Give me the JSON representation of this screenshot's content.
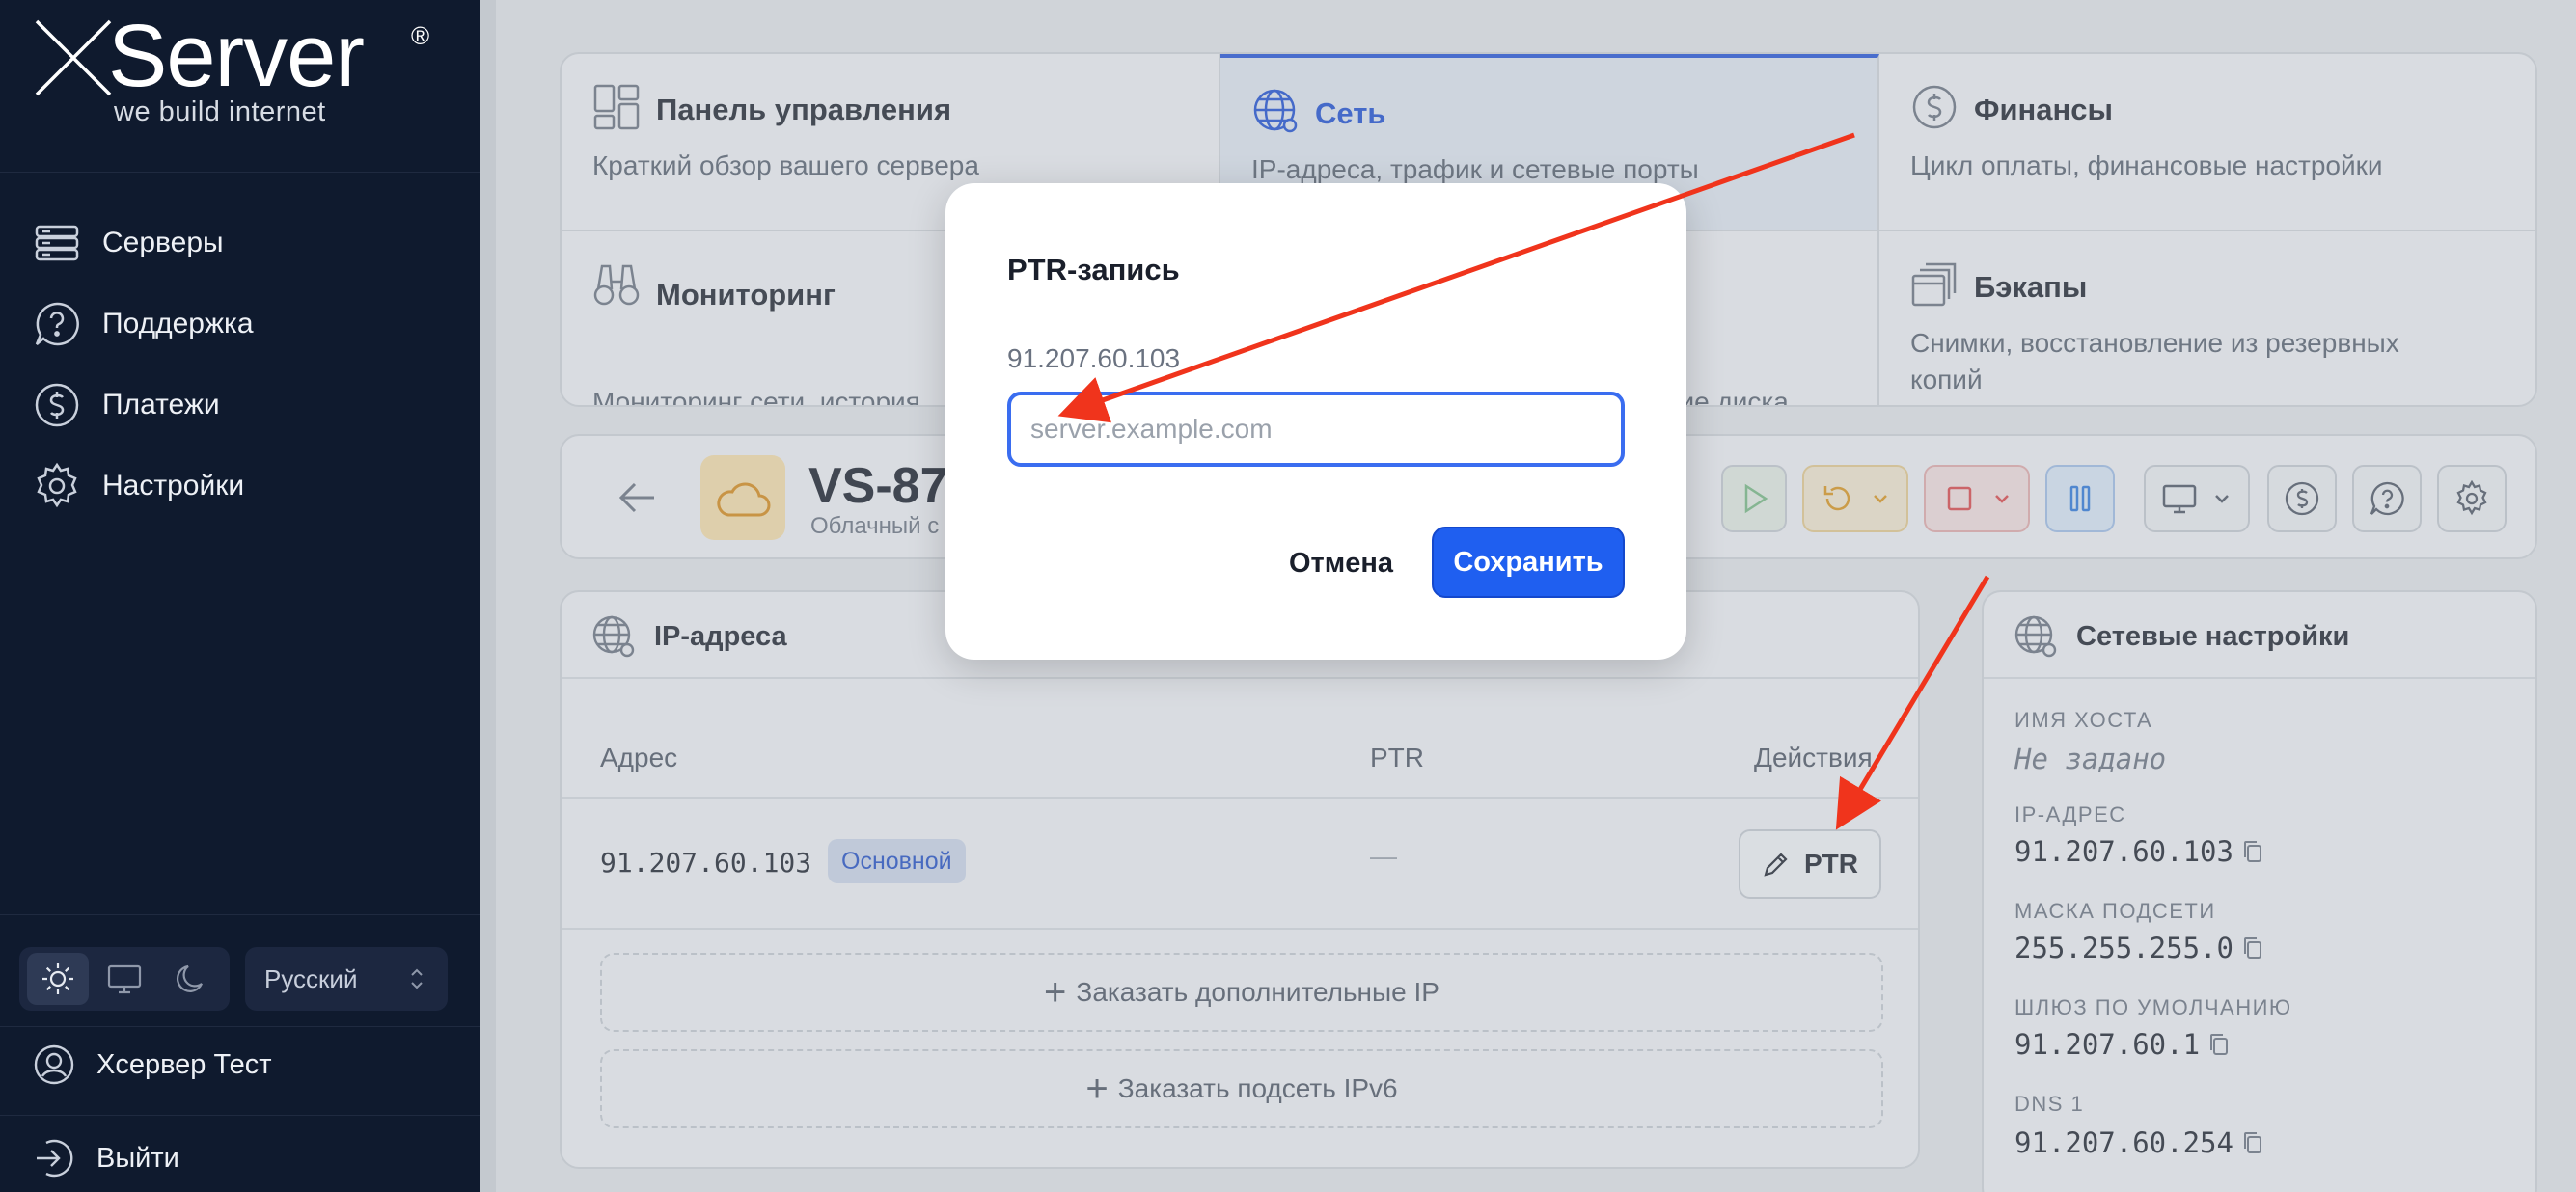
{
  "brand": {
    "name": "XServer",
    "registered": "®",
    "tagline": "we build internet"
  },
  "sidebar": {
    "items": [
      {
        "label": "Серверы",
        "icon": "servers-icon"
      },
      {
        "label": "Поддержка",
        "icon": "support-icon"
      },
      {
        "label": "Платежи",
        "icon": "payments-icon"
      },
      {
        "label": "Настройки",
        "icon": "settings-icon"
      }
    ],
    "theme": {
      "options": [
        "light",
        "system",
        "dark"
      ],
      "selected": "light"
    },
    "language": "Русский",
    "user": "Хсервер Тест",
    "logout": "Выйти"
  },
  "tiles": [
    {
      "title": "Панель управления",
      "desc": "Краткий обзор вашего сервера",
      "icon": "dashboard-icon",
      "active": false
    },
    {
      "title": "Сеть",
      "desc": "IP-адреса, трафик и сетевые порты",
      "icon": "network-icon",
      "active": true
    },
    {
      "title": "Финансы",
      "desc": "Цикл оплаты, финансовые настройки",
      "icon": "finance-icon",
      "active": false
    },
    {
      "title": "Мониторинг",
      "desc": "Мониторинг сети, история",
      "icon": "binoculars-icon",
      "active": false
    },
    {
      "title": "",
      "desc": "ние диска",
      "icon": "",
      "active": false
    },
    {
      "title": "Бэкапы",
      "desc": "Снимки, восстановление из резервных копий",
      "icon": "backups-icon",
      "active": false
    }
  ],
  "server": {
    "name": "VS-87",
    "subtitle": "Облачный с"
  },
  "ip_card": {
    "title": "IP-адреса",
    "columns": [
      "Адрес",
      "PTR",
      "Действия"
    ],
    "rows": [
      {
        "address": "91.207.60.103",
        "badge": "Основной",
        "ptr": "—",
        "action": "PTR"
      }
    ],
    "order_ip": "Заказать дополнительные IP",
    "order_ipv6": "Заказать подсеть IPv6"
  },
  "net_settings": {
    "title": "Сетевые настройки",
    "fields": [
      {
        "label": "ИМЯ ХОСТА",
        "value": "Не задано"
      },
      {
        "label": "IP-АДРЕС",
        "value": "91.207.60.103"
      },
      {
        "label": "МАСКА ПОДСЕТИ",
        "value": "255.255.255.0"
      },
      {
        "label": "ШЛЮЗ ПО УМОЛЧАНИЮ",
        "value": "91.207.60.1"
      },
      {
        "label": "DNS 1",
        "value": "91.207.60.254"
      }
    ]
  },
  "modal": {
    "title": "PTR-запись",
    "ip": "91.207.60.103",
    "input_value": "",
    "placeholder": "server.example.com",
    "cancel": "Отмена",
    "save": "Сохранить"
  },
  "colors": {
    "sidebar_bg": "#0f1a2e",
    "accent": "#1f5ff0",
    "annotation_arrow": "#f0341c"
  }
}
